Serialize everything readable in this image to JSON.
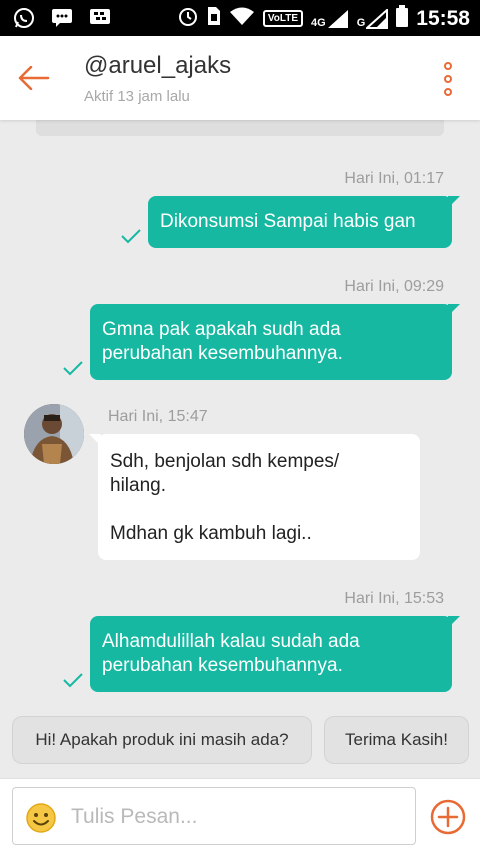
{
  "status_bar": {
    "time": "15:58",
    "volte": "VoLTE",
    "network_1": "4G",
    "network_2": "G"
  },
  "header": {
    "title": "@aruel_ajaks",
    "subtitle": "Aktif 13 jam lalu"
  },
  "messages": [
    {
      "direction": "out",
      "time": "Hari Ini, 01:17",
      "lines": [
        "Dikonsumsi Sampai habis gan"
      ],
      "status": "sent-check"
    },
    {
      "direction": "out",
      "time": "Hari Ini, 09:29",
      "lines": [
        "Gmna pak apakah sudh ada",
        "perubahan kesembuhannya."
      ],
      "status": "sent-check"
    },
    {
      "direction": "in",
      "time": "Hari Ini, 15:47",
      "lines": [
        "Sdh, benjolan sdh kempes/",
        "hilang.",
        "",
        "Mdhan gk kambuh lagi.."
      ]
    },
    {
      "direction": "out",
      "time": "Hari Ini, 15:53",
      "lines": [
        "Alhamdulillah kalau sudah ada",
        "perubahan kesembuhannya."
      ],
      "status": "sent-check"
    }
  ],
  "quick_replies": [
    "Hi! Apakah produk ini masih ada?",
    "Terima Kasih!"
  ],
  "composer": {
    "placeholder": "Tulis Pesan...",
    "emoji_icon": "smiley-icon",
    "add_icon": "plus-circle-icon"
  },
  "colors": {
    "accent": "#e86a35",
    "outgoing_bubble": "#16b8a2",
    "incoming_bubble": "#ffffff",
    "background": "#ebebeb"
  }
}
